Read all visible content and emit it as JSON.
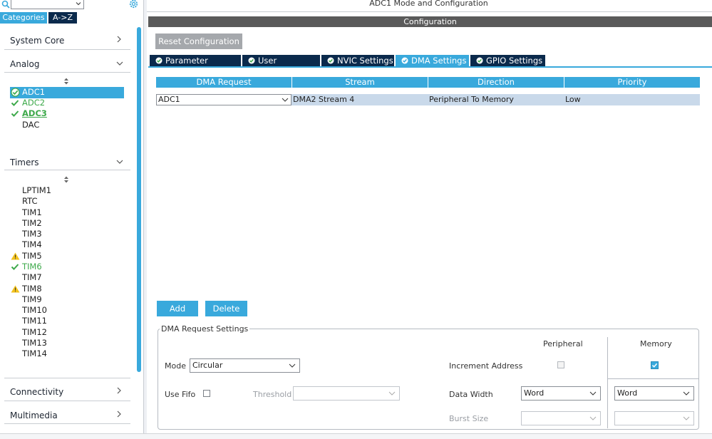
{
  "window": {
    "title": "ADC1 Mode and Configuration"
  },
  "left_panel": {
    "search_value": "",
    "tabs": [
      "Categories",
      "A->Z"
    ],
    "sections": {
      "system_core": "System Core",
      "analog": "Analog",
      "timers": "Timers",
      "connectivity": "Connectivity",
      "multimedia": "Multimedia"
    },
    "analog_items": [
      {
        "label": "ADC1",
        "state": "selected-ok"
      },
      {
        "label": "ADC2",
        "state": "ok"
      },
      {
        "label": "ADC3",
        "state": "ok"
      },
      {
        "label": "DAC",
        "state": "none"
      }
    ],
    "timer_items": [
      {
        "label": "LPTIM1",
        "state": "none"
      },
      {
        "label": "RTC",
        "state": "none"
      },
      {
        "label": "TIM1",
        "state": "none"
      },
      {
        "label": "TIM2",
        "state": "none"
      },
      {
        "label": "TIM3",
        "state": "none"
      },
      {
        "label": "TIM4",
        "state": "none"
      },
      {
        "label": "TIM5",
        "state": "warning"
      },
      {
        "label": "TIM6",
        "state": "ok"
      },
      {
        "label": "TIM7",
        "state": "none"
      },
      {
        "label": "TIM8",
        "state": "warning"
      },
      {
        "label": "TIM9",
        "state": "none"
      },
      {
        "label": "TIM10",
        "state": "none"
      },
      {
        "label": "TIM11",
        "state": "none"
      },
      {
        "label": "TIM12",
        "state": "none"
      },
      {
        "label": "TIM13",
        "state": "none"
      },
      {
        "label": "TIM14",
        "state": "none"
      }
    ]
  },
  "config": {
    "header": "Configuration",
    "reset_label": "Reset Configuration",
    "tabs": [
      {
        "label": "Parameter Settings",
        "active": false
      },
      {
        "label": "User Constants",
        "active": false
      },
      {
        "label": "NVIC Settings",
        "active": false
      },
      {
        "label": "DMA Settings",
        "active": true
      },
      {
        "label": "GPIO Settings",
        "active": false
      }
    ]
  },
  "dma_table": {
    "columns": [
      "DMA Request",
      "Stream",
      "Direction",
      "Priority"
    ],
    "rows": [
      {
        "request": "ADC1",
        "stream": "DMA2 Stream 4",
        "direction": "Peripheral To Memory",
        "priority": "Low"
      }
    ]
  },
  "actions": {
    "add": "Add",
    "delete": "Delete"
  },
  "request_settings": {
    "title": "DMA Request Settings",
    "peripheral_header": "Peripheral",
    "memory_header": "Memory",
    "mode_label": "Mode",
    "mode_value": "Circular",
    "increment_label": "Increment Address",
    "peripheral_increment": false,
    "memory_increment": true,
    "use_fifo_label": "Use Fifo",
    "use_fifo": false,
    "threshold_label": "Threshold",
    "threshold_value": "",
    "data_width_label": "Data Width",
    "peripheral_data_width": "Word",
    "memory_data_width": "Word",
    "burst_label": "Burst Size",
    "peripheral_burst": "",
    "memory_burst": ""
  },
  "colors": {
    "accent": "#39a9dc",
    "navy": "#0b2a4c",
    "ok_green": "#3da94a",
    "warning_yellow": "#f2c11b"
  }
}
